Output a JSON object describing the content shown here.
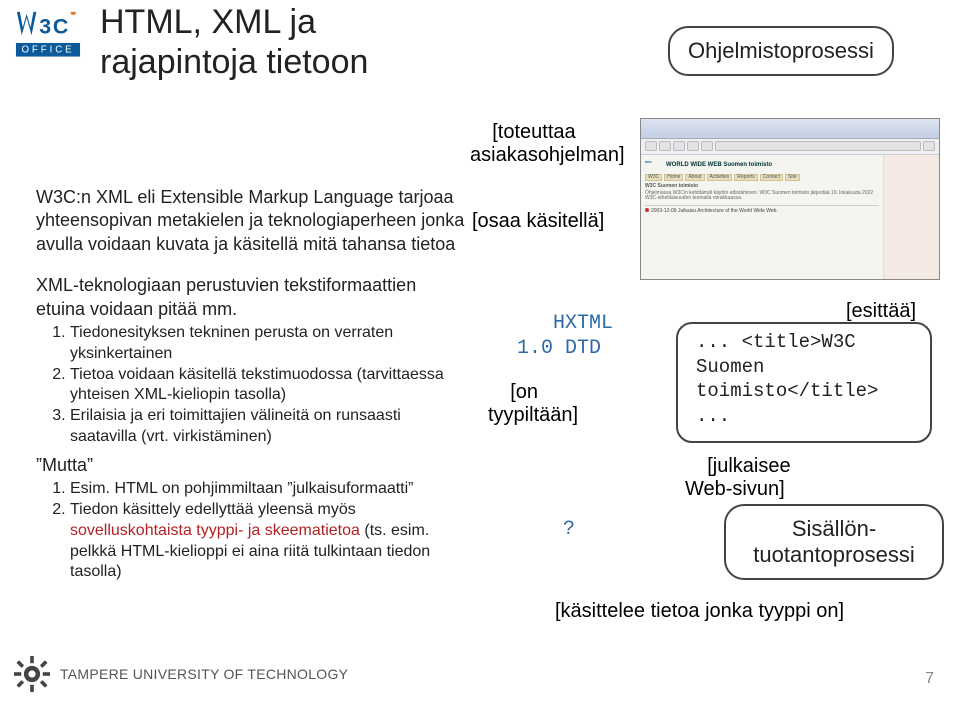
{
  "title_line1": "HTML, XML ja",
  "title_line2": "rajapintoja tietoon",
  "top_right_box": "Ohjelmistoprosessi",
  "annot": {
    "toteuttaa1": "[toteuttaa",
    "toteuttaa2": "asiakasohjelman]",
    "osaa": "[osaa käsitellä]",
    "hxtml1": "HXTML",
    "hxtml2": "1.0 DTD",
    "on1": "[on",
    "on2": "tyypiltään]",
    "esittaa": "[esittää]",
    "julk1": "[julkaisee",
    "julk2": "Web-sivun]",
    "q": "?",
    "bottom": "[käsittelee tietoa jonka tyyppi on]"
  },
  "code_box": {
    "l1": "... <title>W3C",
    "l2": "Suomen",
    "l3": "toimisto</title>",
    "l4": "..."
  },
  "sisal_box_l1": "Sisällön-",
  "sisal_box_l2": "tuotantoprosessi",
  "left": {
    "p1": "W3C:n XML eli Extensible Markup Language tarjoaa yhteensopivan metakielen ja teknologiaperheen jonka avulla voidaan kuvata ja käsitellä mitä tahansa tietoa",
    "p2": "XML-teknologiaan perustuvien tekstiformaattien etuina voidaan pitää mm.",
    "li1": "Tiedonesityksen tekninen perusta on verraten yksinkertainen",
    "li2": "Tietoa voidaan käsitellä tekstimuodossa (tarvittaessa yhteisen XML-kieliopin tasolla)",
    "li3": "Erilaisia ja eri toimittajien välineitä on runsaasti saatavilla (vrt. virkistäminen)",
    "mutta": "”Mutta”",
    "m1a": "Esim. HTML on pohjimmiltaan ”julkaisuformaatti”",
    "m2a": "Tiedon käsittely edellyttää yleensä myös ",
    "m2red": "sovelluskohtaista",
    "m2b": "  tyyppi- ja skeematietoa",
    "m2c": " (ts. esim. pelkkä HTML-kielioppi ei aina riitä tulkintaan tiedon tasolla)"
  },
  "browser": {
    "hdr_name": "W3C Suomen toimisto",
    "hdr_sub": "WORLD WIDE WEB  Suomen toimisto",
    "body_blurb": "Ohjelmassa W3Cin kehittämät käytön edistäminen. W3C Suomen toimisto järjestää 19. lokakuuta 2022 W3C-aihetilaisuuden teemalla mirakkaassa.",
    "news": "2003-12-09 Julkaisu Architecture of the World Wide Web."
  },
  "footer_university": "TAMPERE UNIVERSITY OF TECHNOLOGY",
  "page_number": "7"
}
